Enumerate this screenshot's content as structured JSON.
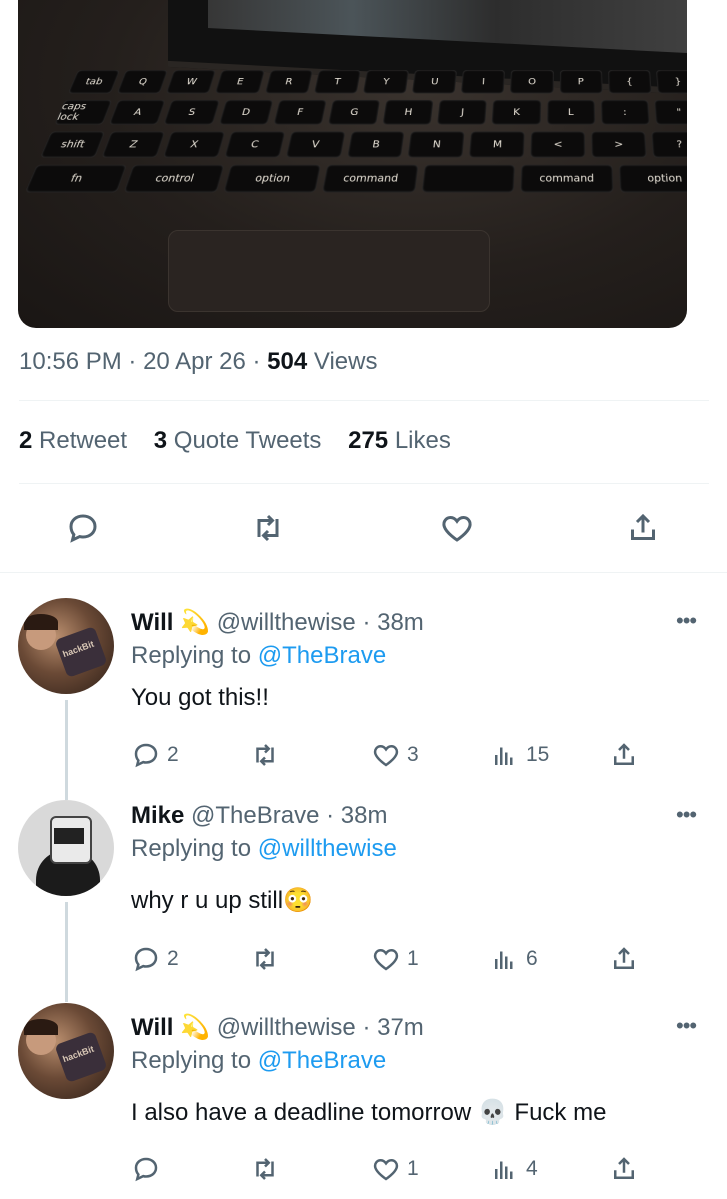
{
  "tweet": {
    "time": "10:56 PM",
    "date": "20 Apr 26",
    "views_count": "504",
    "views_label": "Views",
    "retweets_count": "2",
    "retweets_label": "Retweet",
    "quotes_count": "3",
    "quotes_label": "Quote Tweets",
    "likes_count": "275",
    "likes_label": "Likes",
    "photo_keys": {
      "row1": [
        "tab",
        "Q",
        "W",
        "E",
        "R",
        "T",
        "Y",
        "U",
        "I",
        "O",
        "P",
        "{",
        "}"
      ],
      "row2": [
        "caps lock",
        "A",
        "S",
        "D",
        "F",
        "G",
        "H",
        "J",
        "K",
        "L",
        ":",
        "\""
      ],
      "row3": [
        "shift",
        "Z",
        "X",
        "C",
        "V",
        "B",
        "N",
        "M",
        "<",
        ">",
        "?"
      ],
      "row4": [
        "fn",
        "control",
        "option",
        "command",
        "",
        "command",
        "option"
      ]
    }
  },
  "replies": [
    {
      "name": "Will",
      "badge": "💫",
      "handle": "@willthewise",
      "time": "38m",
      "replying_label": "Replying to",
      "replying_to": "@TheBrave",
      "text": "You got this!!",
      "reply_count": "2",
      "retweet_count": "",
      "like_count": "3",
      "view_count": "15",
      "avatar_text": "hackBit"
    },
    {
      "name": "Mike",
      "badge": "",
      "handle": "@TheBrave",
      "time": "38m",
      "replying_label": "Replying to",
      "replying_to": "@willthewise",
      "text": "why r u up still😳",
      "reply_count": "2",
      "retweet_count": "",
      "like_count": "1",
      "view_count": "6",
      "avatar_text": ""
    },
    {
      "name": "Will",
      "badge": "💫",
      "handle": "@willthewise",
      "time": "37m",
      "replying_label": "Replying to",
      "replying_to": "@TheBrave",
      "text": "I also have a deadline tomorrow 💀  Fuck me",
      "reply_count": "",
      "retweet_count": "",
      "like_count": "1",
      "view_count": "4",
      "avatar_text": "hackBit"
    }
  ],
  "icons": {
    "reply": "reply-icon",
    "retweet": "retweet-icon",
    "like": "heart-icon",
    "views": "views-icon",
    "share": "share-icon",
    "more": "more-icon"
  },
  "colors": {
    "link": "#1d9bf0",
    "secondary_text": "#536471",
    "primary_text": "#0f1419",
    "divider": "#eff3f4"
  }
}
